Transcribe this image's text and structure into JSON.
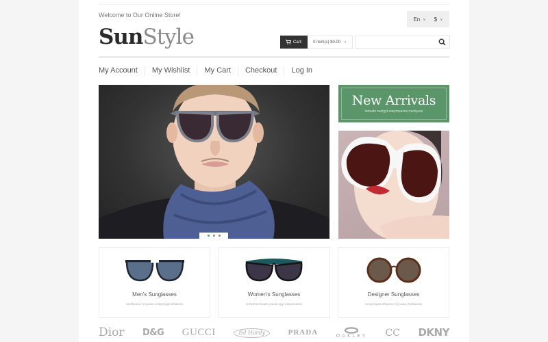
{
  "header": {
    "welcome": "Welcome to Our Online Store!",
    "logo": {
      "part1": "Sun",
      "part2": "Style"
    },
    "language": {
      "selected": "En",
      "icon": "chevron-down-icon"
    },
    "currency": {
      "selected": "$",
      "icon": "chevron-down-icon"
    },
    "cart": {
      "label": "Cart:",
      "summary": "0 item(s) $0.00",
      "icon": "cart-icon"
    },
    "search": {
      "value": "",
      "placeholder": "",
      "icon": "search-icon"
    }
  },
  "nav": {
    "items": [
      {
        "label": "My Account"
      },
      {
        "label": "My Wishlist"
      },
      {
        "label": "My Cart"
      },
      {
        "label": "Checkout"
      },
      {
        "label": "Log In"
      }
    ]
  },
  "slider": {
    "image_alt": "Man wearing aviator sunglasses and blue scarf",
    "slides": 3,
    "active_slide": 1
  },
  "banner": {
    "title": "New Arrivals",
    "subtitle": "lertuats sacigyt easymsases rnertyase"
  },
  "promo_image": {
    "alt": "Woman wearing white oversized sunglasses"
  },
  "categories": [
    {
      "name": "Men's Sunglasses",
      "desc": "asetfasane feryuasa ceasymigyt afsasera"
    },
    {
      "name": "Women's Sunglasses",
      "desc": "vertyertas buats yuasa oigyt easymsases"
    },
    {
      "name": "Designer Sunglasses",
      "desc": "ceasymigas etfasane feryuasa ytiafsasera"
    }
  ],
  "brands": [
    "Dior",
    "D&G",
    "GUCCI",
    "Ed Hardy",
    "PRADA",
    "OAKLEY",
    "CC",
    "DKNY"
  ],
  "colors": {
    "accent_green": "#5b966b",
    "dark": "#333333",
    "background": "#f5f5f5"
  }
}
